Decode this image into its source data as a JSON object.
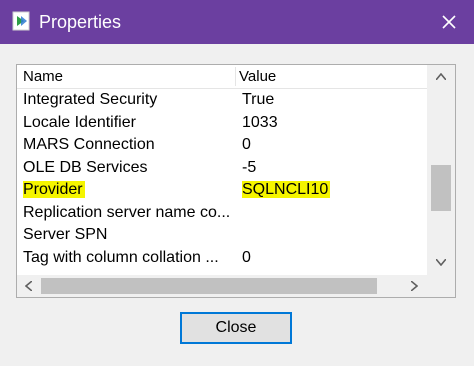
{
  "window": {
    "title": "Properties",
    "accent_color": "#6b3fa0",
    "icon": "app-icon",
    "close_icon": "close-icon"
  },
  "grid": {
    "columns": {
      "name": "Name",
      "value": "Value"
    },
    "rows": [
      {
        "name": "Integrated Security",
        "value": "True",
        "highlighted": false
      },
      {
        "name": "Locale Identifier",
        "value": "1033",
        "highlighted": false
      },
      {
        "name": "MARS Connection",
        "value": "0",
        "highlighted": false
      },
      {
        "name": "OLE DB Services",
        "value": "-5",
        "highlighted": false
      },
      {
        "name": "Provider",
        "value": "SQLNCLI10",
        "highlighted": true
      },
      {
        "name": "Replication server name co...",
        "value": "",
        "highlighted": false
      },
      {
        "name": "Server SPN",
        "value": "",
        "highlighted": false
      },
      {
        "name": "Tag with column collation ...",
        "value": "0",
        "highlighted": false
      }
    ],
    "highlight_color": "#f5f500"
  },
  "footer": {
    "close_label": "Close"
  }
}
